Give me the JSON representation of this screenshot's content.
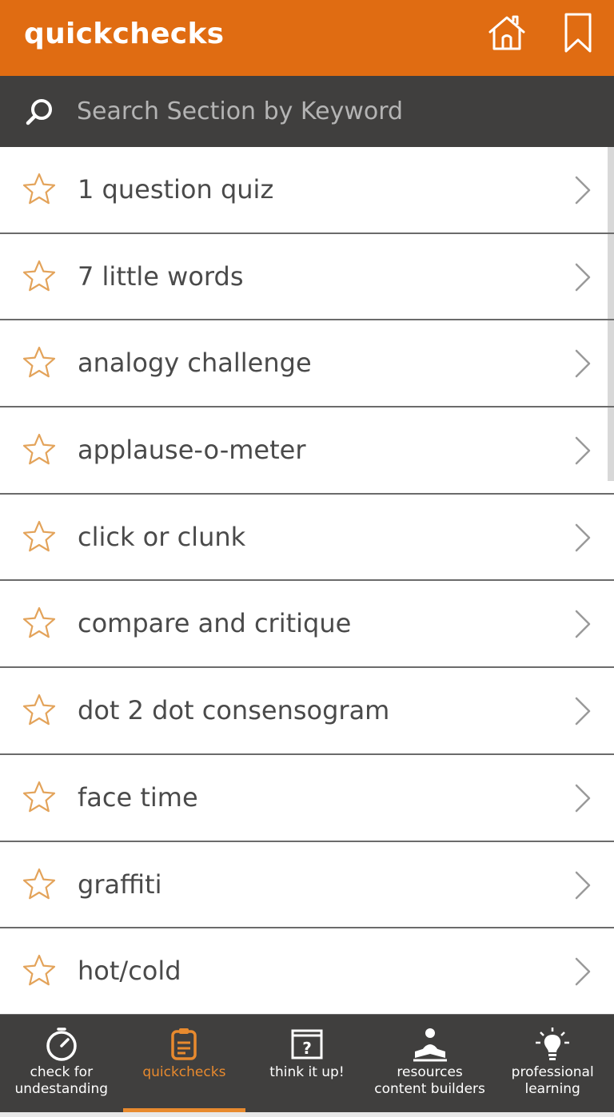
{
  "colors": {
    "brand_orange": "#e06c12",
    "search_bg": "#403f3e",
    "nav_bg": "#403f3e",
    "active_accent": "#e88a2e",
    "star_outline": "#e3a35a"
  },
  "header": {
    "title": "quickchecks",
    "home_icon": "home-icon",
    "bookmark_icon": "bookmark-icon"
  },
  "search": {
    "placeholder": "Search Section by Keyword",
    "value": "",
    "icon": "search-icon"
  },
  "list": {
    "items": [
      {
        "label": "1 question quiz"
      },
      {
        "label": "7 little words"
      },
      {
        "label": "analogy challenge"
      },
      {
        "label": "applause-o-meter"
      },
      {
        "label": "click or clunk"
      },
      {
        "label": "compare and critique"
      },
      {
        "label": "dot 2 dot consensogram"
      },
      {
        "label": "face time"
      },
      {
        "label": "graffiti"
      },
      {
        "label": "hot/cold"
      }
    ]
  },
  "bottom_nav": {
    "items": [
      {
        "label_line1": "check for",
        "label_line2": "undestanding",
        "icon": "stopwatch-icon",
        "active": false
      },
      {
        "label_line1": "quickchecks",
        "label_line2": "",
        "icon": "clipboard-icon",
        "active": true
      },
      {
        "label_line1": "think it up!",
        "label_line2": "",
        "icon": "question-window-icon",
        "active": false
      },
      {
        "label_line1": "resources",
        "label_line2": "content builders",
        "icon": "reader-icon",
        "active": false
      },
      {
        "label_line1": "professional",
        "label_line2": "learning",
        "icon": "lightbulb-icon",
        "active": false
      }
    ]
  }
}
